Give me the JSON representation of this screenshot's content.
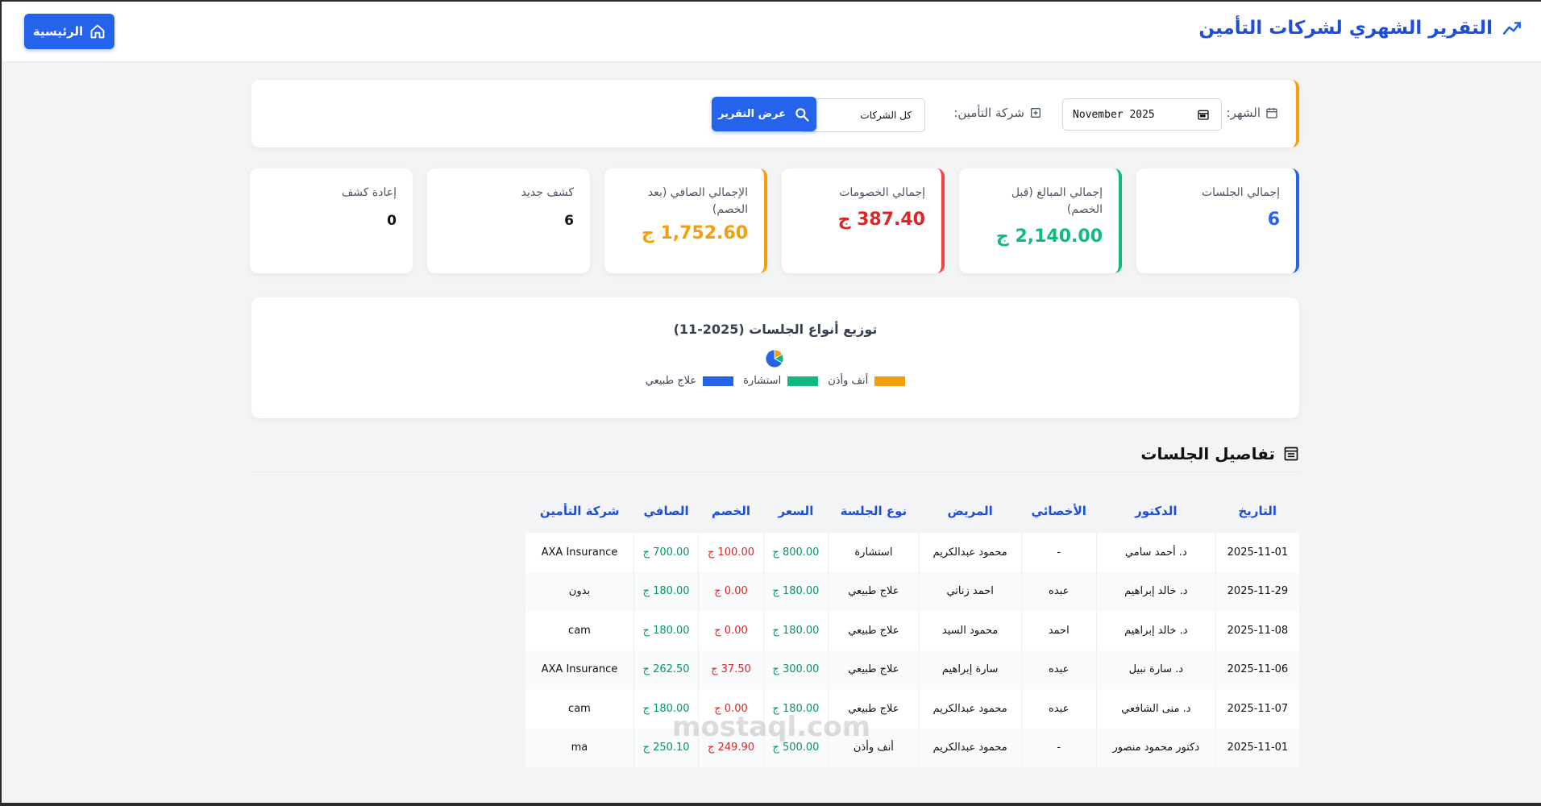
{
  "header": {
    "title": "التقرير الشهري لشركات التأمين",
    "home_label": "الرئيسية"
  },
  "filters": {
    "month_label": "الشهر:",
    "month_value": "November  2025",
    "company_label": "شركة التأمين:",
    "company_selected": "كل الشركات",
    "report_button": "عرض التقرير"
  },
  "stats": [
    {
      "label": "إجمالي الجلسات",
      "value": "6",
      "color": "#2563eb"
    },
    {
      "label": "إجمالي المبالغ (قبل الخصم)",
      "value": "2,140.00 ج",
      "color": "#10b981"
    },
    {
      "label": "إجمالي الخصومات",
      "value": "387.40 ج",
      "color": "#dc2626"
    },
    {
      "label": "الإجمالي الصافي (بعد الخصم)",
      "value": "1,752.60 ج",
      "color": "#f59e0b"
    },
    {
      "label": "كشف جديد",
      "value": "6"
    },
    {
      "label": "إعادة كشف",
      "value": "0"
    }
  ],
  "chart_data": {
    "type": "pie",
    "title": "توزيع أنواع الجلسات (2025-11)",
    "categories": [
      "أنف وأذن",
      "استشارة",
      "علاج طبيعي"
    ],
    "values": [
      1,
      1,
      4
    ],
    "colors": [
      "#f59e0b",
      "#10b981",
      "#2563eb"
    ]
  },
  "sessions": {
    "title": "تفاصيل الجلسات",
    "columns": [
      "التاريخ",
      "الدكتور",
      "الأخصائي",
      "المريض",
      "نوع الجلسة",
      "السعر",
      "الخصم",
      "الصافي",
      "شركة التأمين"
    ],
    "rows": [
      [
        "2025-11-01",
        "د. أحمد سامي",
        "-",
        "محمود عبدالكريم",
        "استشارة",
        "800.00 ج",
        "100.00 ج",
        "700.00 ج",
        "AXA Insurance"
      ],
      [
        "2025-11-29",
        "د. خالد إبراهيم",
        "عبده",
        "احمد زناتي",
        "علاج طبيعي",
        "180.00 ج",
        "0.00 ج",
        "180.00 ج",
        "بدون"
      ],
      [
        "2025-11-08",
        "د. خالد إبراهيم",
        "احمد",
        "محمود السيد",
        "علاج طبيعي",
        "180.00 ج",
        "0.00 ج",
        "180.00 ج",
        "cam"
      ],
      [
        "2025-11-06",
        "د. سارة نبيل",
        "عبده",
        "سارة إبراهيم",
        "علاج طبيعي",
        "300.00 ج",
        "37.50 ج",
        "262.50 ج",
        "AXA Insurance"
      ],
      [
        "2025-11-07",
        "د. منى الشافعي",
        "عبده",
        "محمود عبدالكريم",
        "علاج طبيعي",
        "180.00 ج",
        "0.00 ج",
        "180.00 ج",
        "cam"
      ],
      [
        "2025-11-01",
        "دكتور محمود منصور",
        "-",
        "محمود عبدالكريم",
        "أنف وأذن",
        "500.00 ج",
        "249.90 ج",
        "250.10 ج",
        "ma"
      ]
    ]
  },
  "watermark": "mostaql.com"
}
